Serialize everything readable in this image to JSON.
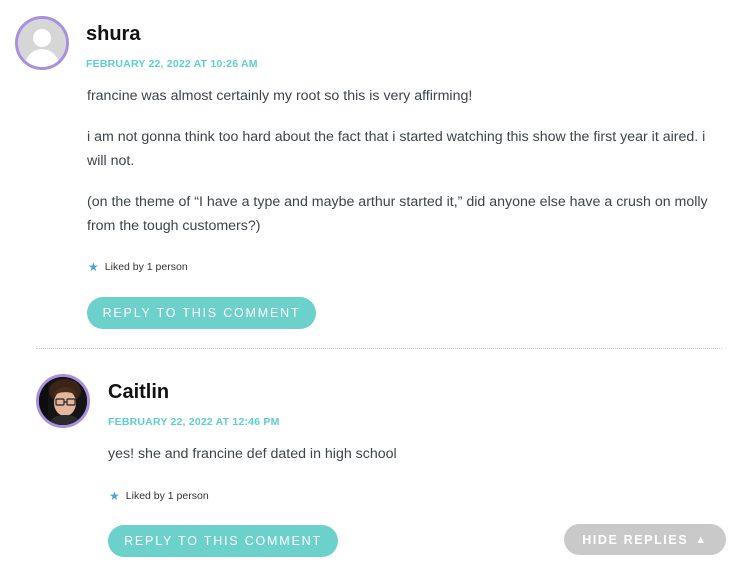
{
  "comments": [
    {
      "author": "shura",
      "date": "FEBRUARY 22, 2022 AT 10:26 AM",
      "paragraphs": [
        "francine was almost certainly my root so this is very affirming!",
        "i am not gonna think too hard about the fact that i started watching this show the first year it aired. i will not.",
        "(on the theme of “I have a type and maybe arthur started it,” did anyone else have a crush on molly from the tough customers?)"
      ],
      "likes": "Liked by 1 person",
      "reply_label": "REPLY TO THIS COMMENT",
      "avatar_icon": "default-user-avatar"
    },
    {
      "author": "Caitlin",
      "date": "FEBRUARY 22, 2022 AT 12:46 PM",
      "paragraphs": [
        "yes! she and francine def dated in high school"
      ],
      "likes": "Liked by 1 person",
      "reply_label": "REPLY TO THIS COMMENT",
      "avatar_icon": "user-photo-avatar"
    }
  ],
  "hide_replies_label": "HIDE REPLIES",
  "colors": {
    "accent": "#5ccfd0",
    "button": "#6dd1cb",
    "avatar_ring": "#a98fe0",
    "hide_button": "#c9c9c9"
  }
}
